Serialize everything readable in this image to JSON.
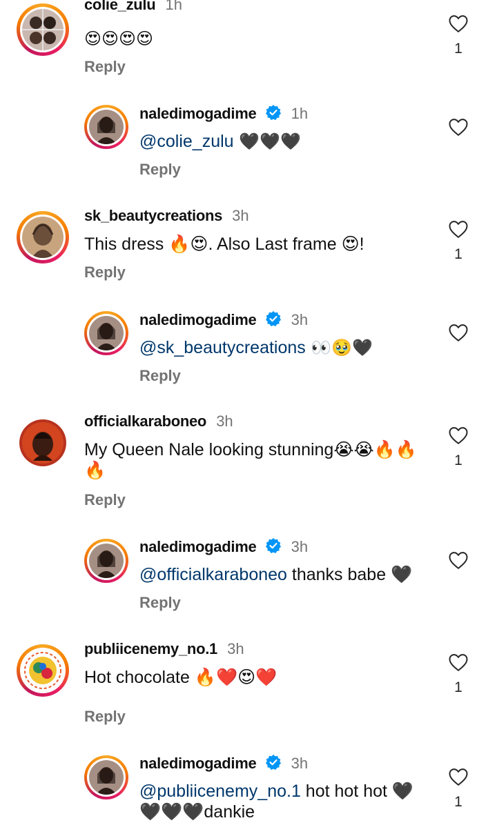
{
  "comments": [
    {
      "username": "colie_zulu",
      "time": "1h",
      "text": "😍😍😍😍",
      "reply": "Reply",
      "likes": "1"
    },
    {
      "username": "naledimogadime",
      "time": "1h",
      "mention": "@colie_zulu",
      "text": " 🖤🖤🖤",
      "reply": "Reply"
    },
    {
      "username": "sk_beautycreations",
      "time": "3h",
      "text": "This dress 🔥😍. Also Last frame 😍!",
      "reply": "Reply",
      "likes": "1"
    },
    {
      "username": "naledimogadime",
      "time": "3h",
      "mention": "@sk_beautycreations",
      "text": " 👀🥹🖤",
      "reply": "Reply"
    },
    {
      "username": "officialkaraboneo",
      "time": "3h",
      "text": "My Queen Nale looking stunning😭😭🔥🔥🔥",
      "reply": "Reply",
      "likes": "1"
    },
    {
      "username": "naledimogadime",
      "time": "3h",
      "mention": "@officialkaraboneo",
      "text": " thanks babe 🖤",
      "reply": "Reply"
    },
    {
      "username": "publiicenemy_no.1",
      "time": "3h",
      "text": "Hot chocolate 🔥❤️😍❤️",
      "reply": "Reply",
      "likes": "1"
    },
    {
      "username": "naledimogadime",
      "time": "3h",
      "mention": "@publiicenemy_no.1",
      "text": " hot hot hot 🖤🖤🖤🖤dankie",
      "likes": "1"
    }
  ],
  "icons": {
    "like": "heart-outline-icon",
    "verified": "verified-badge-icon"
  },
  "colors": {
    "mention": "#00376b",
    "verified": "#0095f6",
    "secondary_text": "#737373"
  }
}
